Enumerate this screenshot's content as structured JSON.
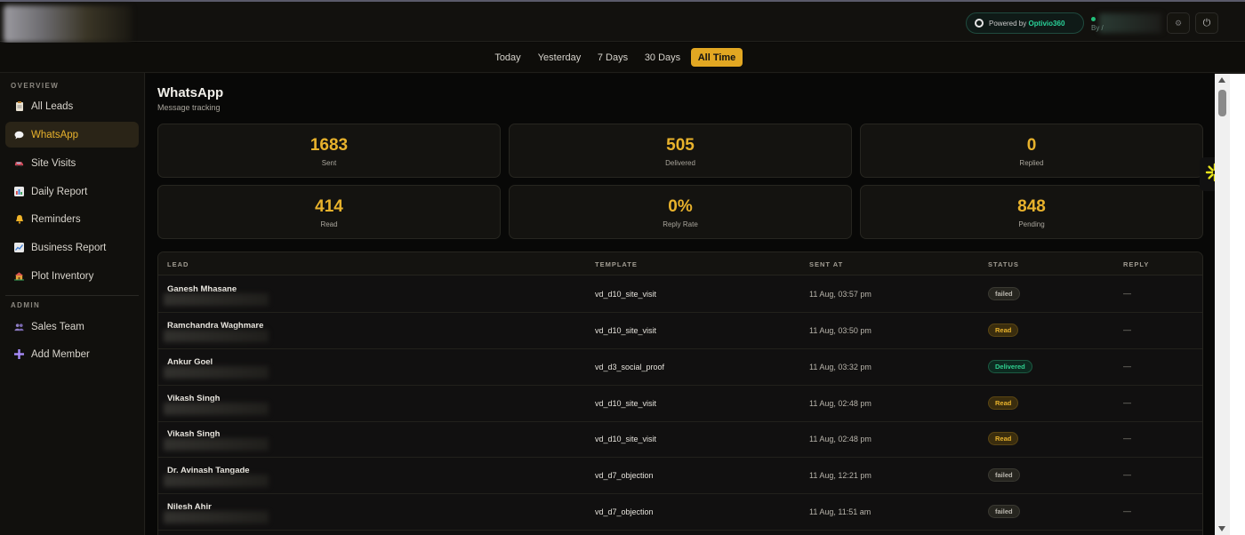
{
  "header": {
    "powered_prefix": "Powered by",
    "powered_brand": "Optivio360",
    "user_by": "By /"
  },
  "ranges": [
    {
      "label": "Today"
    },
    {
      "label": "Yesterday"
    },
    {
      "label": "7 Days"
    },
    {
      "label": "30 Days"
    },
    {
      "label": "All Time",
      "active": true
    }
  ],
  "sidebar": {
    "overview_label": "OVERVIEW",
    "admin_label": "ADMIN",
    "items": [
      {
        "label": "All Leads",
        "icon": "clipboard-icon"
      },
      {
        "label": "WhatsApp",
        "icon": "chat-icon",
        "active": true
      },
      {
        "label": "Site Visits",
        "icon": "car-icon"
      },
      {
        "label": "Daily Report",
        "icon": "bar-chart-icon"
      },
      {
        "label": "Reminders",
        "icon": "bell-icon"
      },
      {
        "label": "Business Report",
        "icon": "line-chart-icon"
      },
      {
        "label": "Plot Inventory",
        "icon": "house-icon"
      }
    ],
    "admin_items": [
      {
        "label": "Sales Team",
        "icon": "people-icon"
      },
      {
        "label": "Add Member",
        "icon": "plus-icon"
      }
    ]
  },
  "page": {
    "title": "WhatsApp",
    "subtitle": "Message tracking"
  },
  "stats": [
    {
      "value": "1683",
      "label": "Sent"
    },
    {
      "value": "505",
      "label": "Delivered"
    },
    {
      "value": "0",
      "label": "Replied"
    },
    {
      "value": "414",
      "label": "Read"
    },
    {
      "value": "0%",
      "label": "Reply Rate"
    },
    {
      "value": "848",
      "label": "Pending"
    }
  ],
  "table": {
    "columns": [
      "LEAD",
      "TEMPLATE",
      "SENT AT",
      "STATUS",
      "REPLY"
    ],
    "rows": [
      {
        "lead": "Ganesh Mhasane",
        "template": "vd_d10_site_visit",
        "sent_at": "11 Aug, 03:57 pm",
        "status": "failed",
        "reply": "—"
      },
      {
        "lead": "Ramchandra Waghmare",
        "template": "vd_d10_site_visit",
        "sent_at": "11 Aug, 03:50 pm",
        "status": "Read",
        "reply": "—"
      },
      {
        "lead": "Ankur Goel",
        "template": "vd_d3_social_proof",
        "sent_at": "11 Aug, 03:32 pm",
        "status": "Delivered",
        "reply": "—"
      },
      {
        "lead": "Vikash Singh",
        "template": "vd_d10_site_visit",
        "sent_at": "11 Aug, 02:48 pm",
        "status": "Read",
        "reply": "—"
      },
      {
        "lead": "Vikash Singh",
        "template": "vd_d10_site_visit",
        "sent_at": "11 Aug, 02:48 pm",
        "status": "Read",
        "reply": "—"
      },
      {
        "lead": "Dr. Avinash Tangade",
        "template": "vd_d7_objection",
        "sent_at": "11 Aug, 12:21 pm",
        "status": "failed",
        "reply": "—"
      },
      {
        "lead": "Nilesh Ahir",
        "template": "vd_d7_objection",
        "sent_at": "11 Aug, 11:51 am",
        "status": "failed",
        "reply": "—"
      }
    ]
  }
}
